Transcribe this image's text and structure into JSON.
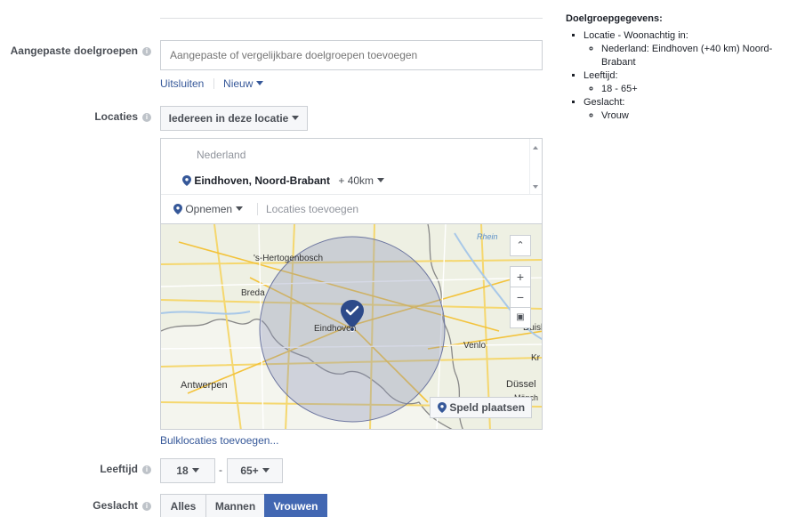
{
  "form": {
    "custom_audiences": {
      "label": "Aangepaste doelgroepen",
      "placeholder": "Aangepaste of vergelijkbare doelgroepen toevoegen",
      "exclude_link": "Uitsluiten",
      "new_link": "Nieuw"
    },
    "locations": {
      "label": "Locaties",
      "dropdown_value": "Iedereen in deze locatie",
      "country": "Nederland",
      "selected_location": "Eindhoven, Noord-Brabant",
      "radius": "+ 40km",
      "include_label": "Opnemen",
      "add_locations_placeholder": "Locaties toevoegen",
      "bulk_link": "Bulklocaties toevoegen..."
    },
    "map": {
      "place_pin_button": "Speld plaatsen",
      "zoom_in": "+",
      "zoom_out": "−",
      "labels": {
        "hertogenbosch": "'s-Hertogenbosch",
        "breda": "Breda",
        "eindhoven": "Eindhoven",
        "venlo": "Venlo",
        "antwerpen": "Antwerpen",
        "rhein": "Rhein",
        "dusseldorf": "Düssel",
        "duisb": "Duisb",
        "kr": "Kr",
        "monch": "Mönch"
      }
    },
    "age": {
      "label": "Leeftijd",
      "min": "18",
      "separator": "-",
      "max": "65+"
    },
    "gender": {
      "label": "Geslacht",
      "options": [
        "Alles",
        "Mannen",
        "Vrouwen"
      ],
      "selected": "Vrouwen"
    }
  },
  "summary": {
    "title": "Doelgroepgegevens:",
    "location_label": "Locatie - Woonachtig in:",
    "location_value": "Nederland: Eindhoven (+40 km) Noord-Brabant",
    "age_label": "Leeftijd:",
    "age_value": "18 - 65+",
    "gender_label": "Geslacht:",
    "gender_value": "Vrouw"
  },
  "colors": {
    "primary": "#4267b2",
    "link": "#365899",
    "radius_fill": "#8a93b8"
  }
}
